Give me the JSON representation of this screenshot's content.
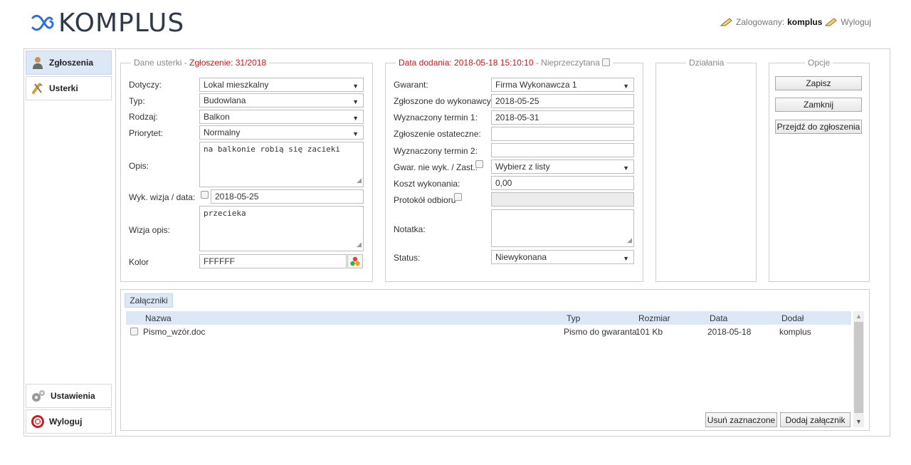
{
  "header": {
    "logo_text": "KOMPLUS",
    "logged_label": "Zalogowany:",
    "username": "komplus",
    "logout_link": "Wyloguj"
  },
  "sidebar": {
    "items": [
      {
        "label": "Zgłoszenia",
        "icon": "user-icon"
      },
      {
        "label": "Usterki",
        "icon": "tools-icon"
      },
      {
        "label": "Ustawienia",
        "icon": "gears-icon"
      },
      {
        "label": "Wyloguj",
        "icon": "power-icon"
      }
    ]
  },
  "defect": {
    "legend": "Dane usterki - ",
    "legend_red": "Zgłoszenie: 31/2018",
    "dotyczy_label": "Dotyczy:",
    "dotyczy_value": "Lokal mieszkalny",
    "typ_label": "Typ:",
    "typ_value": "Budowlana",
    "rodzaj_label": "Rodzaj:",
    "rodzaj_value": "Balkon",
    "priorytet_label": "Priorytet:",
    "priorytet_value": "Normalny",
    "opis_label": "Opis:",
    "opis_value": "na balkonie robią się zacieki",
    "wizja_label": "Wyk. wizja / data:",
    "wizja_date": "2018-05-25",
    "wizja_opis_label": "Wizja opis:",
    "wizja_opis_value": "przecieka",
    "kolor_label": "Kolor",
    "kolor_value": "FFFFFF"
  },
  "dates": {
    "legend_red": "Data dodania: 2018-05-18 15:10:10",
    "legend_gray": " - Nieprzeczytana",
    "gwarant_label": "Gwarant:",
    "gwarant_value": "Firma Wykonawcza 1",
    "zgloszone_label": "Zgłoszone do wykonawcy:",
    "zgloszone_value": "2018-05-25",
    "termin1_label": "Wyznaczony termin 1:",
    "termin1_value": "2018-05-31",
    "ostateczne_label": "Zgłoszenie ostateczne:",
    "ostateczne_value": "",
    "termin2_label": "Wyznaczony termin 2:",
    "termin2_value": "",
    "gwar_label": "Gwar. nie wyk. / Zast.:",
    "gwar_value": "Wybierz z listy",
    "koszt_label": "Koszt wykonania:",
    "koszt_value": "0,00",
    "protokol_label": "Protokół odbioru",
    "protokol_value": "",
    "notatka_label": "Notatka:",
    "notatka_value": "",
    "status_label": "Status:",
    "status_value": "Niewykonana"
  },
  "actions": {
    "legend": "Działania"
  },
  "options": {
    "legend": "Opcje",
    "save": "Zapisz",
    "close": "Zamknij",
    "goto": "Przejdź do zgłoszenia"
  },
  "attachments": {
    "tab": "Załączniki",
    "columns": [
      "Nazwa",
      "Typ",
      "Rozmiar",
      "Data",
      "Dodał"
    ],
    "rows": [
      {
        "name": "Pismo_wzór.doc",
        "type": "Pismo do gwaranta",
        "size": "101 Kb",
        "date": "2018-05-18",
        "added_by": "komplus"
      }
    ],
    "delete_selected": "Usuń zaznaczone",
    "add": "Dodaj załącznik"
  }
}
